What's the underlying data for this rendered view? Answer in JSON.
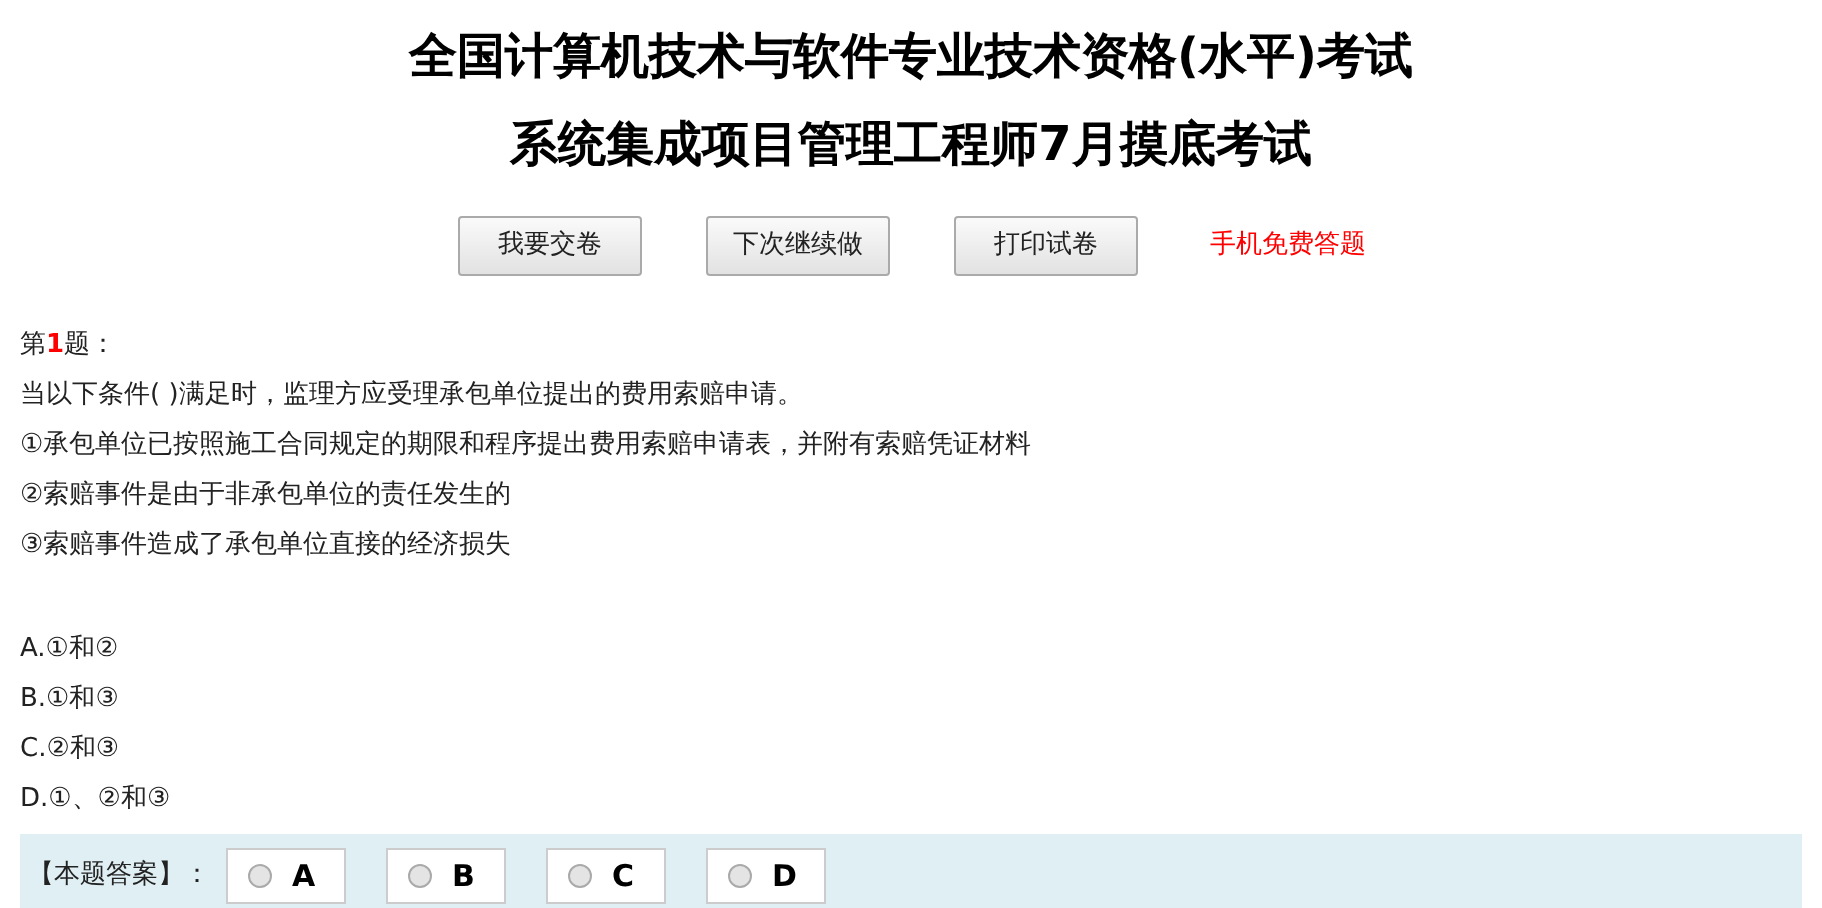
{
  "title_lines": [
    "全国计算机技术与软件专业技术资格(水平)考试",
    "系统集成项目管理工程师7月摸底考试"
  ],
  "buttons": [
    "我要交卷",
    "下次继续做",
    "打印试卷"
  ],
  "mobile_link": "手机免费答题",
  "question": {
    "label_before": "第",
    "number": "1",
    "label_after": "题：",
    "lines": [
      "当以下条件( )满足时，监理方应受理承包单位提出的费用索赔申请。",
      "①承包单位已按照施工合同规定的期限和程序提出费用索赔申请表，并附有索赔凭证材料",
      "②索赔事件是由于非承包单位的责任发生的",
      "③索赔事件造成了承包单位直接的经济损失"
    ],
    "options": [
      "A.①和②",
      "B.①和③",
      "C.②和③",
      "D.①、②和③"
    ]
  },
  "answer": {
    "label": "【本题答案】：",
    "choices": [
      {
        "label": "A",
        "selected": false
      },
      {
        "label": "B",
        "selected": false
      },
      {
        "label": "C",
        "selected": false
      },
      {
        "label": "D",
        "selected": false
      }
    ]
  }
}
